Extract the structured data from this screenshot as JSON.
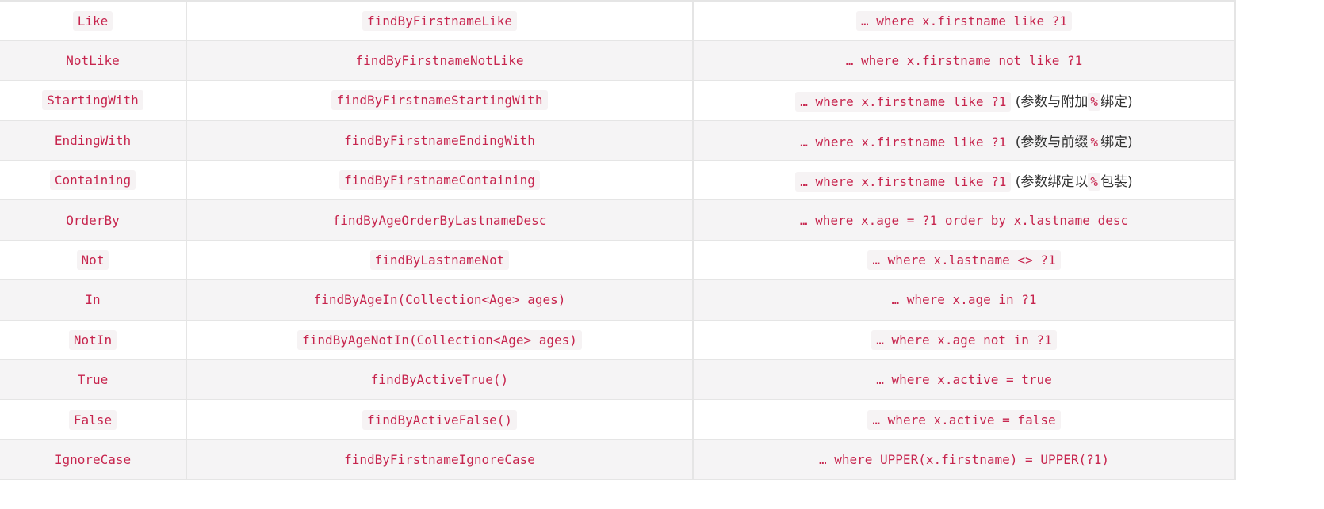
{
  "rows": [
    {
      "keyword": "Like",
      "sample": "findByFirstnameLike",
      "jpql": "… where x.firstname like ?1",
      "note_pre": "",
      "note_post": ""
    },
    {
      "keyword": "NotLike",
      "sample": "findByFirstnameNotLike",
      "jpql": "… where x.firstname not like ?1",
      "note_pre": "",
      "note_post": ""
    },
    {
      "keyword": "StartingWith",
      "sample": "findByFirstnameStartingWith",
      "jpql": "… where x.firstname like ?1",
      "note_pre": "(参数与附加",
      "note_pct": "%",
      "note_post": "绑定)"
    },
    {
      "keyword": "EndingWith",
      "sample": "findByFirstnameEndingWith",
      "jpql": "… where x.firstname like ?1",
      "note_pre": "(参数与前缀",
      "note_pct": "%",
      "note_post": "绑定)"
    },
    {
      "keyword": "Containing",
      "sample": "findByFirstnameContaining",
      "jpql": "… where x.firstname like ?1",
      "note_pre": "(参数绑定以",
      "note_pct": "%",
      "note_post": "包装)"
    },
    {
      "keyword": "OrderBy",
      "sample": "findByAgeOrderByLastnameDesc",
      "jpql": "… where x.age = ?1 order by x.lastname desc",
      "note_pre": "",
      "note_post": ""
    },
    {
      "keyword": "Not",
      "sample": "findByLastnameNot",
      "jpql": "… where x.lastname <> ?1",
      "note_pre": "",
      "note_post": ""
    },
    {
      "keyword": "In",
      "sample": "findByAgeIn(Collection<Age> ages)",
      "jpql": "… where x.age in ?1",
      "note_pre": "",
      "note_post": ""
    },
    {
      "keyword": "NotIn",
      "sample": "findByAgeNotIn(Collection<Age> ages)",
      "jpql": "… where x.age not in ?1",
      "note_pre": "",
      "note_post": ""
    },
    {
      "keyword": "True",
      "sample": "findByActiveTrue()",
      "jpql": "… where x.active = true",
      "note_pre": "",
      "note_post": ""
    },
    {
      "keyword": "False",
      "sample": "findByActiveFalse()",
      "jpql": "… where x.active = false",
      "note_pre": "",
      "note_post": ""
    },
    {
      "keyword": "IgnoreCase",
      "sample": "findByFirstnameIgnoreCase",
      "jpql": "… where UPPER(x.firstname) = UPPER(?1)",
      "note_pre": "",
      "note_post": ""
    }
  ],
  "colors": {
    "code_text": "#c7254e",
    "code_bg": "#f6f3f4",
    "row_alt_bg": "#f5f4f5",
    "border": "#e5e5e5"
  }
}
